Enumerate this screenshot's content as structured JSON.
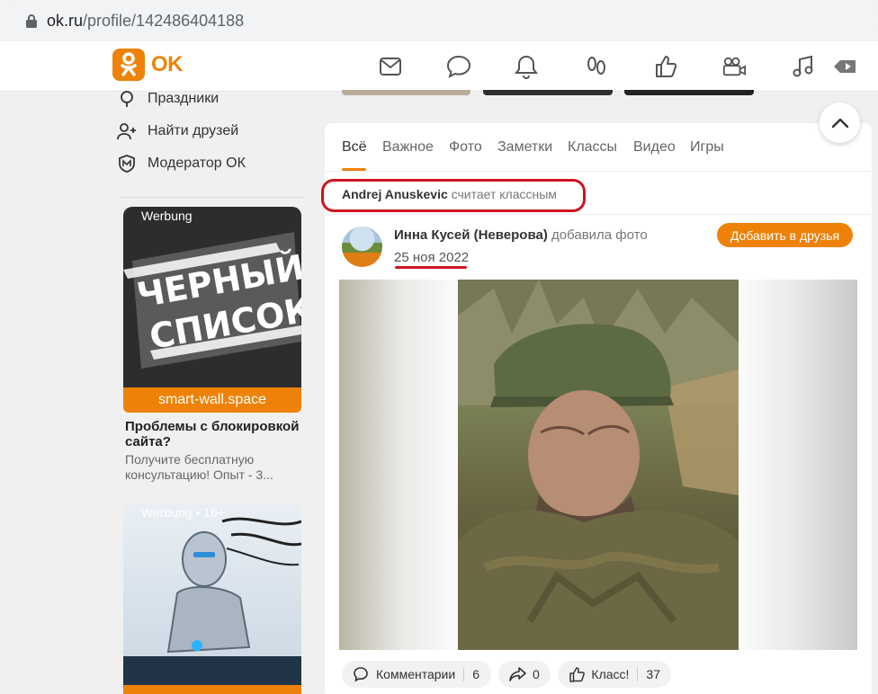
{
  "browser": {
    "url_host": "ok.ru",
    "url_path": "/profile/142486404188"
  },
  "brand": {
    "logo_text": "OK",
    "accent": "#ee8208"
  },
  "nav_icons": [
    "mail-icon",
    "chat-icon",
    "bell-icon",
    "footprints-icon",
    "like-icon",
    "video-camera-icon",
    "music-icon",
    "video-play-icon"
  ],
  "sidebar": {
    "items": [
      {
        "label": "Праздники",
        "icon": "gift-icon"
      },
      {
        "label": "Найти друзей",
        "icon": "add-user-icon"
      },
      {
        "label": "Модератор ОК",
        "icon": "moderator-icon"
      }
    ]
  },
  "ads": [
    {
      "tag": "Werbung",
      "image_text_line1": "ЧЕРНЫЙ",
      "image_text_line2": "СПИСОК",
      "domain": "smart-wall.space",
      "title": "Проблемы с блокировкой сайта?",
      "description": "Получите бесплатную консультацию! Опыт - 3..."
    },
    {
      "tag": "Werbung • 16+"
    }
  ],
  "feed": {
    "tabs": [
      "Всё",
      "Важное",
      "Фото",
      "Заметки",
      "Классы",
      "Видео",
      "Игры"
    ],
    "active_tab": "Всё",
    "liked_by": {
      "name": "Andrej Anuskevic",
      "action": "считает классным"
    },
    "post": {
      "author": "Инна Кусей (Неверова)",
      "action": "добавила фото",
      "date": "25 ноя 2022",
      "add_friend_label": "Добавить в друзья"
    },
    "actions": {
      "comments_label": "Комментарии",
      "comments_count": "6",
      "shares_count": "0",
      "likes_label": "Класс!",
      "likes_count": "37"
    }
  },
  "highlight_color": "#d0141e"
}
